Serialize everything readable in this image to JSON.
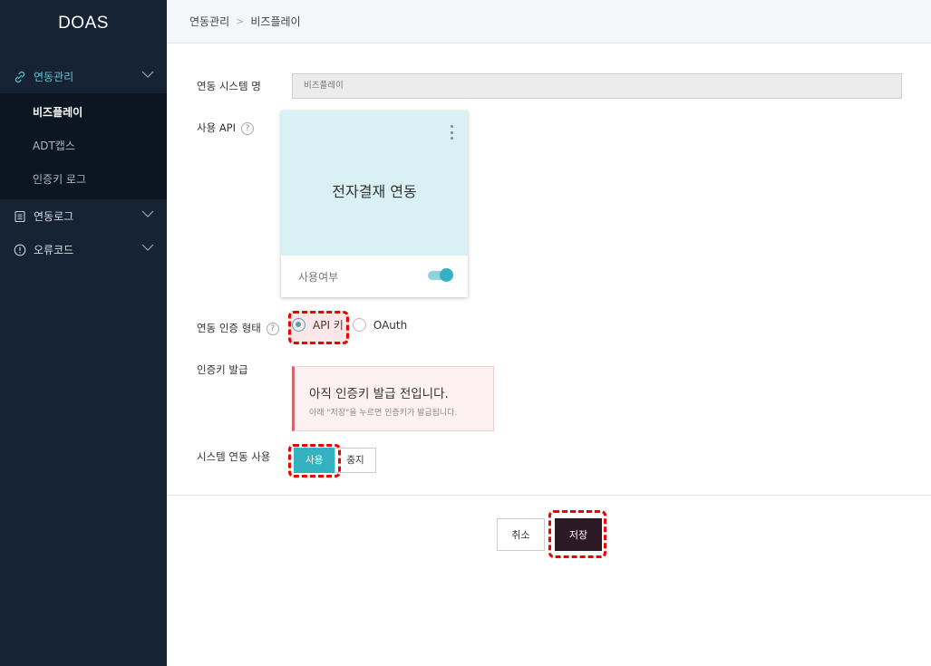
{
  "app": {
    "logo": "DOAS"
  },
  "sidebar": {
    "groups": [
      {
        "label": "연동관리",
        "icon": "link-icon",
        "expanded": true
      },
      {
        "label": "연동로그",
        "icon": "document-icon",
        "expanded": false
      },
      {
        "label": "오류코드",
        "icon": "alert-circle-icon",
        "expanded": false
      }
    ],
    "subitems": [
      {
        "label": "비즈플레이",
        "active": true
      },
      {
        "label": "ADT캡스",
        "active": false
      },
      {
        "label": "인증키 로그",
        "active": false
      }
    ],
    "accent_color": "#5ec2cf",
    "background": "#162335"
  },
  "breadcrumb": {
    "parent": "연동관리",
    "separator": ">",
    "current": "비즈플레이"
  },
  "form": {
    "system_name": {
      "label": "연동 시스템 명",
      "value": "비즈플레이"
    },
    "api": {
      "label": "사용 API",
      "help": "?",
      "card_title": "전자결재 연동",
      "usage_label": "사용여부",
      "usage_enabled": true
    },
    "auth_type": {
      "label": "연동 인증 형태",
      "help": "?",
      "options": [
        {
          "label": "API 키",
          "selected": true
        },
        {
          "label": "OAuth",
          "selected": false
        }
      ]
    },
    "auth_key": {
      "label": "인증키 발급",
      "notice_title": "아직 인증키 발급 전입니다.",
      "notice_sub": "아래 \"저장\"을 누르면 인증키가 발급됩니다."
    },
    "system_usage": {
      "label": "시스템 연동 사용",
      "options": [
        {
          "label": "사용",
          "selected": true
        },
        {
          "label": "중지",
          "selected": false
        }
      ]
    }
  },
  "actions": {
    "cancel": "취소",
    "save": "저장"
  },
  "colors": {
    "accent": "#35b2c2",
    "save_button": "#2b1a26",
    "highlight": "#e00000"
  }
}
